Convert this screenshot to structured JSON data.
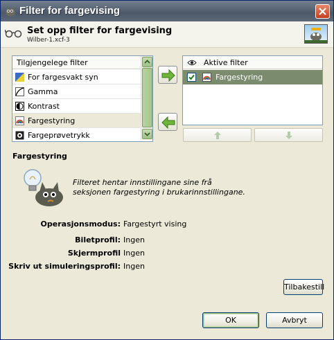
{
  "window": {
    "title": "Filter for fargevising",
    "colors": {
      "titlebar": "#5a6676",
      "accent_green": "#7a8b6e",
      "close": "#c2401f"
    }
  },
  "header": {
    "title": "Set opp filter for fargevising",
    "subtitle": "Wilber-1.xcf-3"
  },
  "available": {
    "column_label": "Tilgjengelege filter",
    "items": [
      {
        "label": "For fargesvakt syn",
        "icon": "color-deficient-icon",
        "selected": false
      },
      {
        "label": "Gamma",
        "icon": "gamma-icon",
        "selected": false
      },
      {
        "label": "Kontrast",
        "icon": "contrast-icon",
        "selected": false
      },
      {
        "label": "Fargestyring",
        "icon": "color-management-icon",
        "selected": true
      },
      {
        "label": "Fargeprøvetrykk",
        "icon": "proof-icon",
        "selected": false
      }
    ]
  },
  "active": {
    "column_label": "Aktive filter",
    "items": [
      {
        "label": "Fargestyring",
        "checked": true,
        "icon": "color-management-icon"
      }
    ]
  },
  "details": {
    "title": "Fargestyring",
    "description_line1": "Filteret hentar innstillingane sine frå",
    "description_line2": "seksjonen fargestyring i brukarinnstillingane.",
    "props": [
      {
        "label": "Operasjonsmodus:",
        "value": "Fargestyrt vising"
      },
      {
        "label": "Biletprofil:",
        "value": "Ingen"
      },
      {
        "label": "Skjermprofil",
        "value": "Ingen"
      },
      {
        "label": "Skriv ut simuleringsprofil:",
        "value": "Ingen"
      }
    ]
  },
  "buttons": {
    "reset": "Tilbakestill",
    "ok": "OK",
    "cancel": "Avbryt"
  }
}
